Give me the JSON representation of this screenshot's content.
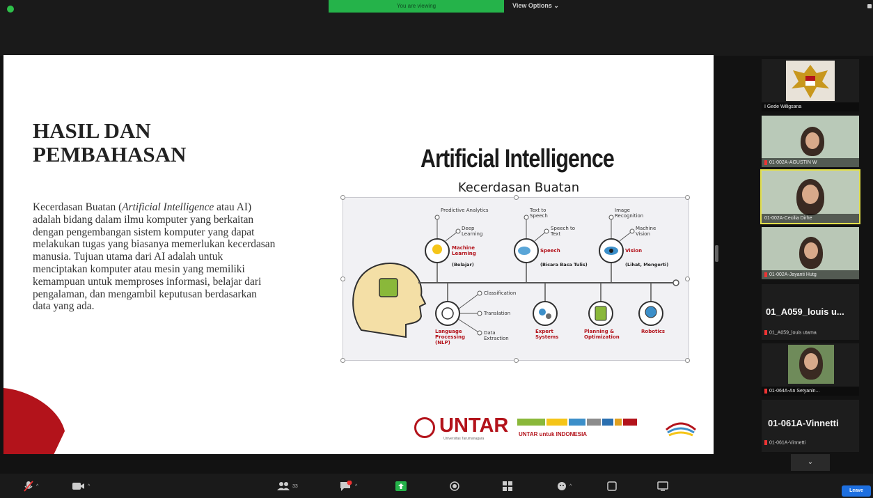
{
  "meeting": {
    "share_banner": "You are viewing ",
    "view_options": "View Options",
    "leave_label": "Leave"
  },
  "slide": {
    "title_line1": "HASIL DAN",
    "title_line2": "PEMBAHASAN",
    "body_part1": "Kecerdasan Buatan (",
    "body_italic": "Artificial Intelligence",
    "body_part2": " atau AI) adalah bidang dalam ilmu komputer yang berkaitan dengan pengembangan sistem komputer yang dapat melakukan tugas yang biasanya memerlukan kecerdasan manusia. Tujuan utama dari AI adalah untuk menciptakan komputer atau mesin yang memiliki kemampuan untuk memproses informasi, belajar dari pengalaman, dan mengambil keputusan berdasarkan data yang ada.",
    "ai_heading": "Artificial Intelligence",
    "ai_subheading": "Kecerdasan Buatan",
    "untar": "UNTAR",
    "untar_sub": "Universitas Tarumanagara",
    "untar_indonesia": "UNTAR untuk INDONESIA"
  },
  "diagram": {
    "top": [
      {
        "leaf1": "Predictive Analytics",
        "leaf2": "Deep Learning",
        "name": "Machine Learning",
        "note": "(Belajar)"
      },
      {
        "leaf1": "Text to Speech",
        "leaf2": "Speech to Text",
        "name": "Speech",
        "note": "(Bicara Baca Tulis)"
      },
      {
        "leaf1": "Image Recognition",
        "leaf2": "Machine Vision",
        "name": "Vision",
        "note": "(Lihat, Mengerti)"
      }
    ],
    "bottom": {
      "nlp": {
        "name": "Language Processing (NLP)",
        "leaf1": "Classification",
        "leaf2": "Translation",
        "leaf3": "Data Extraction"
      },
      "expert": "Expert Systems",
      "planning": "Planning & Optimization",
      "robotics": "Robotics"
    }
  },
  "participants": [
    {
      "name": "I Gede Wiligsana",
      "type": "image"
    },
    {
      "name": "01-002A-AGUSTIN W",
      "type": "video"
    },
    {
      "name": "01-002A-Cecilia Dirhe",
      "type": "video",
      "active": true
    },
    {
      "name": "01-002A-Jayanti Hutg",
      "type": "video"
    },
    {
      "title": "01_A059_louis u...",
      "name": "01_A059_louis utama",
      "type": "text"
    },
    {
      "name": "01-064A-An Setyanin...",
      "type": "video"
    },
    {
      "title": "01-061A-Vinnetti",
      "name": "01-061A-Vinnetti",
      "type": "text"
    }
  ],
  "colors": {
    "accent_red": "#b3131b",
    "banner_green": "#25b34a",
    "leave_blue": "#1d6fe0",
    "active_yellow": "#e3e04a"
  },
  "icons": [
    "mic-icon",
    "video-icon",
    "participants-icon",
    "chat-icon",
    "share-icon",
    "record-icon",
    "apps-icon",
    "reactions-icon",
    "whiteboard-icon",
    "notes-icon",
    "chevron-down-icon"
  ]
}
